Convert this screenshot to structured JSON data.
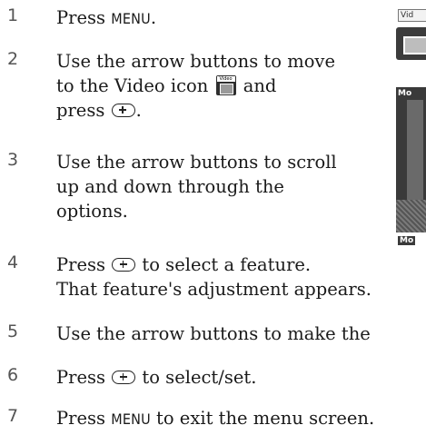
{
  "steps": [
    {
      "number": "1",
      "lines": [
        "Press",
        "MENU",
        "."
      ]
    },
    {
      "number": "2",
      "text_1": "Use the arrow buttons to move",
      "text_2": "to the Video icon",
      "text_3": "and",
      "text_4": "press",
      "text_5": "."
    },
    {
      "number": "3",
      "text_1": "Use the arrow buttons to scroll",
      "text_2": "up and down through the",
      "text_3": "options."
    },
    {
      "number": "4",
      "text_1": "Press",
      "text_2": "to select a feature.",
      "text_3": "That feature's adjustment appears."
    },
    {
      "number": "5",
      "text_1": "Use the arrow buttons to make the"
    },
    {
      "number": "6",
      "text_1": "Press",
      "text_2": "to select/set."
    },
    {
      "number": "7",
      "text_1": "Press",
      "text_2": "MENU",
      "text_3": "to exit the menu screen."
    }
  ],
  "icons": {
    "video_icon": "video-icon",
    "enter_button": "enter-button-icon",
    "video_icon_tag": "Video",
    "side_tab_label": "Vid",
    "side_panel_header": "Mo",
    "side_footer_label": "Mo"
  }
}
